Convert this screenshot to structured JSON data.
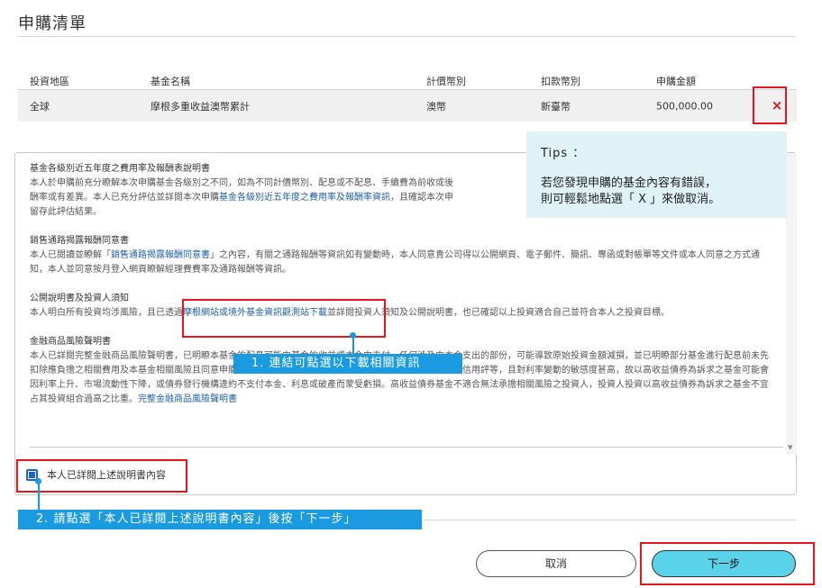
{
  "page": {
    "title": "申購清單"
  },
  "table": {
    "headers": [
      "投資地區",
      "基金名稱",
      "計價幣別",
      "扣款幣別",
      "申購金額"
    ],
    "rows": [
      {
        "region": "全球",
        "fund": "摩根多重收益澳幣累計",
        "currency": "澳幣",
        "debit_currency": "新臺幣",
        "amount": "500,000.00",
        "delete_label": "×"
      }
    ]
  },
  "disclosure": {
    "sections": [
      {
        "title": "基金各級別近五年度之費用率及報酬表說明書",
        "body_1": "本人於申購前充分瞭解本次申購基金各級別之不同，如為不同計價幣別、配息或不配息、手續費為前收或後",
        "body_2": "酬率或有差異。本人已充分評估並詳閱本次申購",
        "link": "基金各級別近五年度之費用率及報酬率資訊",
        "body_3": "，且確認本次申",
        "body_4": "留存此評估結果。"
      },
      {
        "title": "銷售通路揭露報酬同意書",
        "body_1": "本人已閱讀並瞭解「",
        "link": "銷售通路揭露報酬同意書",
        "body_2": "」之內容，有關之通路報酬等資訊如有變動時，本人同意貴公司得以公開網頁、電子郵件、簡訊、專函或對帳單等文件或本人同意之方式通知，本人並同意按月登入網頁瞭解經理費費率及通路報酬等資訊。"
      },
      {
        "title": "公開說明書及投資人須知",
        "body_1": "本人明白所有投資均涉風險，且已透過",
        "link": "摩根網站或境外基金資訊觀測站下載",
        "body_2": "並詳閱投資人須知及公開說明書，也已確認以上投資適合自己並符合本人之投資目標。"
      },
      {
        "title": "金融商品風險聲明書",
        "body_1": "本人已詳閱完整金融商品風險聲明書，已明瞭本基金的配息可能由基金的收益或本金中支付，任何涉及由本金支出的部份，可能導致原始投資金額減損，並已明瞭部分基金進行配息前未先扣除應負擔之相關費用及本基金相關風險且同意申購本基金。由於高收益債券之信用評等未達投資等級或未經信用評等，且對利率變動的敏感度甚高，故以高收益債券為訴求之基金可能會因利率上升、市場流動性下降，或債券發行機構違約不支付本金、利息或破產而蒙受虧損。高收益債券基金不適合無法承擔相關風險之投資人，投資人投資以高收益債券為訴求之基金不宜占其投資組合過高之比重。",
        "link": "完整金融商品風險聲明書"
      }
    ],
    "checkbox_label": "本人已詳閱上述說明書內容",
    "checkbox_checked": true
  },
  "tips": {
    "title": "Tips ：",
    "line_1": "若您發現申購的基金內容有錯誤，",
    "line_2": "則可輕鬆地點選「 X 」來做取消。"
  },
  "annotations": {
    "note_1": "1. 連結可點選以下載相關資訊",
    "note_2": "2. 請點選「本人已詳閱上述說明書內容」後按「下一步」"
  },
  "buttons": {
    "cancel": "取消",
    "next": "下一步"
  },
  "colors": {
    "accent_blue": "#1a9ae0",
    "next_button": "#5ad2e9",
    "highlight_red": "#e8151c",
    "tips_bg": "#dff2f6",
    "link": "#1f5fa8"
  }
}
